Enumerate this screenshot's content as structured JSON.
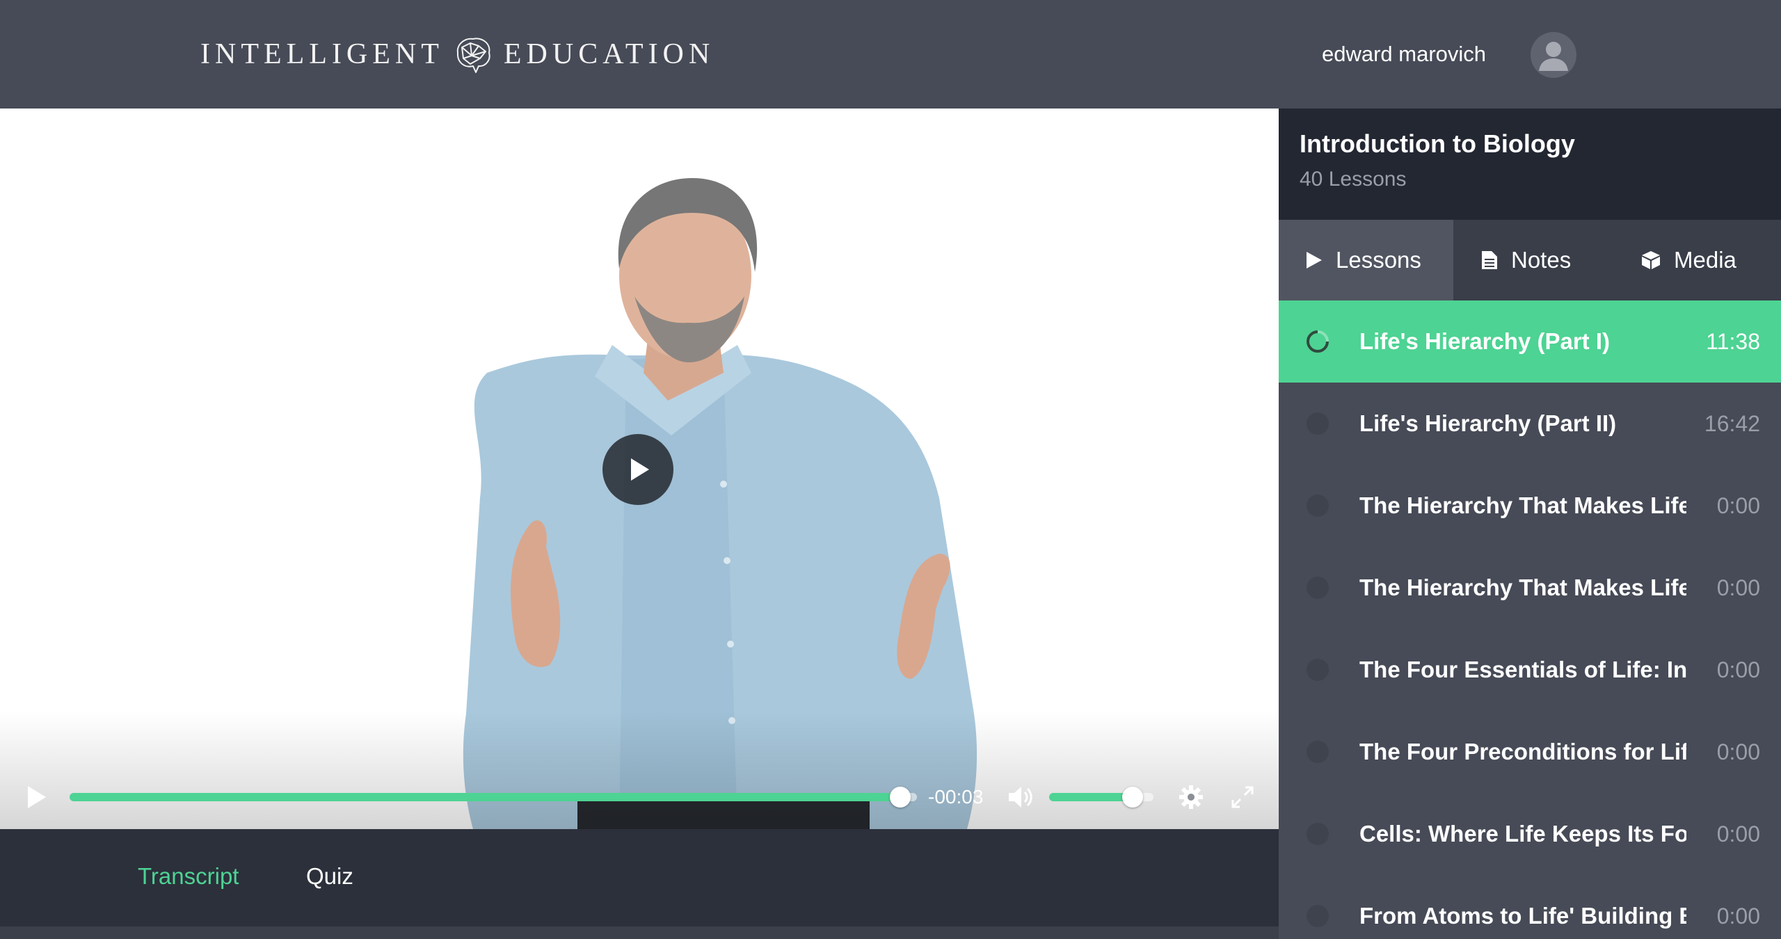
{
  "header": {
    "brand_left": "INTELLIGENT",
    "brand_right": "EDUCATION",
    "user_name": "edward marovich"
  },
  "player": {
    "time_remaining": "-00:03",
    "progress_fraction": 0.98,
    "volume_fraction": 0.8,
    "accent_color": "#4dd393"
  },
  "bottom_tabs": [
    {
      "label": "Transcript",
      "active": true
    },
    {
      "label": "Quiz",
      "active": false
    }
  ],
  "course": {
    "title": "Introduction to Biology",
    "lesson_count": "40 Lessons"
  },
  "sidebar_tabs": [
    {
      "label": "Lessons",
      "icon": "play-icon",
      "active": true
    },
    {
      "label": "Notes",
      "icon": "document-icon",
      "active": false
    },
    {
      "label": "Media",
      "icon": "cube-icon",
      "active": false
    }
  ],
  "lessons": [
    {
      "title": "Life's Hierarchy (Part I)",
      "duration": "11:38",
      "current": true
    },
    {
      "title": "Life's Hierarchy (Part II)",
      "duration": "16:42",
      "current": false
    },
    {
      "title": "The Hierarchy That Makes Life ...",
      "duration": "0:00",
      "current": false
    },
    {
      "title": "The Hierarchy That Makes Life ...",
      "duration": "0:00",
      "current": false
    },
    {
      "title": "The Four Essentials of Life: Info...",
      "duration": "0:00",
      "current": false
    },
    {
      "title": "The Four Preconditions for Life...",
      "duration": "0:00",
      "current": false
    },
    {
      "title": "Cells: Where Life Keeps Its Fou...",
      "duration": "0:00",
      "current": false
    },
    {
      "title": "From Atoms to Life' Building Bl...",
      "duration": "0:00",
      "current": false
    }
  ]
}
